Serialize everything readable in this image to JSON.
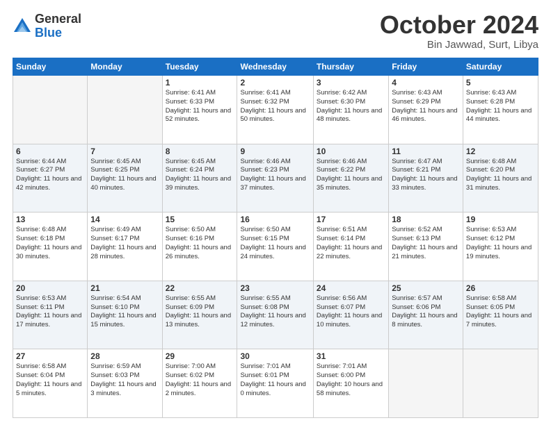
{
  "logo": {
    "general": "General",
    "blue": "Blue"
  },
  "title": "October 2024",
  "subtitle": "Bin Jawwad, Surt, Libya",
  "days_of_week": [
    "Sunday",
    "Monday",
    "Tuesday",
    "Wednesday",
    "Thursday",
    "Friday",
    "Saturday"
  ],
  "weeks": [
    [
      {
        "day": "",
        "info": ""
      },
      {
        "day": "",
        "info": ""
      },
      {
        "day": "1",
        "info": "Sunrise: 6:41 AM\nSunset: 6:33 PM\nDaylight: 11 hours and 52 minutes."
      },
      {
        "day": "2",
        "info": "Sunrise: 6:41 AM\nSunset: 6:32 PM\nDaylight: 11 hours and 50 minutes."
      },
      {
        "day": "3",
        "info": "Sunrise: 6:42 AM\nSunset: 6:30 PM\nDaylight: 11 hours and 48 minutes."
      },
      {
        "day": "4",
        "info": "Sunrise: 6:43 AM\nSunset: 6:29 PM\nDaylight: 11 hours and 46 minutes."
      },
      {
        "day": "5",
        "info": "Sunrise: 6:43 AM\nSunset: 6:28 PM\nDaylight: 11 hours and 44 minutes."
      }
    ],
    [
      {
        "day": "6",
        "info": "Sunrise: 6:44 AM\nSunset: 6:27 PM\nDaylight: 11 hours and 42 minutes."
      },
      {
        "day": "7",
        "info": "Sunrise: 6:45 AM\nSunset: 6:25 PM\nDaylight: 11 hours and 40 minutes."
      },
      {
        "day": "8",
        "info": "Sunrise: 6:45 AM\nSunset: 6:24 PM\nDaylight: 11 hours and 39 minutes."
      },
      {
        "day": "9",
        "info": "Sunrise: 6:46 AM\nSunset: 6:23 PM\nDaylight: 11 hours and 37 minutes."
      },
      {
        "day": "10",
        "info": "Sunrise: 6:46 AM\nSunset: 6:22 PM\nDaylight: 11 hours and 35 minutes."
      },
      {
        "day": "11",
        "info": "Sunrise: 6:47 AM\nSunset: 6:21 PM\nDaylight: 11 hours and 33 minutes."
      },
      {
        "day": "12",
        "info": "Sunrise: 6:48 AM\nSunset: 6:20 PM\nDaylight: 11 hours and 31 minutes."
      }
    ],
    [
      {
        "day": "13",
        "info": "Sunrise: 6:48 AM\nSunset: 6:18 PM\nDaylight: 11 hours and 30 minutes."
      },
      {
        "day": "14",
        "info": "Sunrise: 6:49 AM\nSunset: 6:17 PM\nDaylight: 11 hours and 28 minutes."
      },
      {
        "day": "15",
        "info": "Sunrise: 6:50 AM\nSunset: 6:16 PM\nDaylight: 11 hours and 26 minutes."
      },
      {
        "day": "16",
        "info": "Sunrise: 6:50 AM\nSunset: 6:15 PM\nDaylight: 11 hours and 24 minutes."
      },
      {
        "day": "17",
        "info": "Sunrise: 6:51 AM\nSunset: 6:14 PM\nDaylight: 11 hours and 22 minutes."
      },
      {
        "day": "18",
        "info": "Sunrise: 6:52 AM\nSunset: 6:13 PM\nDaylight: 11 hours and 21 minutes."
      },
      {
        "day": "19",
        "info": "Sunrise: 6:53 AM\nSunset: 6:12 PM\nDaylight: 11 hours and 19 minutes."
      }
    ],
    [
      {
        "day": "20",
        "info": "Sunrise: 6:53 AM\nSunset: 6:11 PM\nDaylight: 11 hours and 17 minutes."
      },
      {
        "day": "21",
        "info": "Sunrise: 6:54 AM\nSunset: 6:10 PM\nDaylight: 11 hours and 15 minutes."
      },
      {
        "day": "22",
        "info": "Sunrise: 6:55 AM\nSunset: 6:09 PM\nDaylight: 11 hours and 13 minutes."
      },
      {
        "day": "23",
        "info": "Sunrise: 6:55 AM\nSunset: 6:08 PM\nDaylight: 11 hours and 12 minutes."
      },
      {
        "day": "24",
        "info": "Sunrise: 6:56 AM\nSunset: 6:07 PM\nDaylight: 11 hours and 10 minutes."
      },
      {
        "day": "25",
        "info": "Sunrise: 6:57 AM\nSunset: 6:06 PM\nDaylight: 11 hours and 8 minutes."
      },
      {
        "day": "26",
        "info": "Sunrise: 6:58 AM\nSunset: 6:05 PM\nDaylight: 11 hours and 7 minutes."
      }
    ],
    [
      {
        "day": "27",
        "info": "Sunrise: 6:58 AM\nSunset: 6:04 PM\nDaylight: 11 hours and 5 minutes."
      },
      {
        "day": "28",
        "info": "Sunrise: 6:59 AM\nSunset: 6:03 PM\nDaylight: 11 hours and 3 minutes."
      },
      {
        "day": "29",
        "info": "Sunrise: 7:00 AM\nSunset: 6:02 PM\nDaylight: 11 hours and 2 minutes."
      },
      {
        "day": "30",
        "info": "Sunrise: 7:01 AM\nSunset: 6:01 PM\nDaylight: 11 hours and 0 minutes."
      },
      {
        "day": "31",
        "info": "Sunrise: 7:01 AM\nSunset: 6:00 PM\nDaylight: 10 hours and 58 minutes."
      },
      {
        "day": "",
        "info": ""
      },
      {
        "day": "",
        "info": ""
      }
    ]
  ]
}
